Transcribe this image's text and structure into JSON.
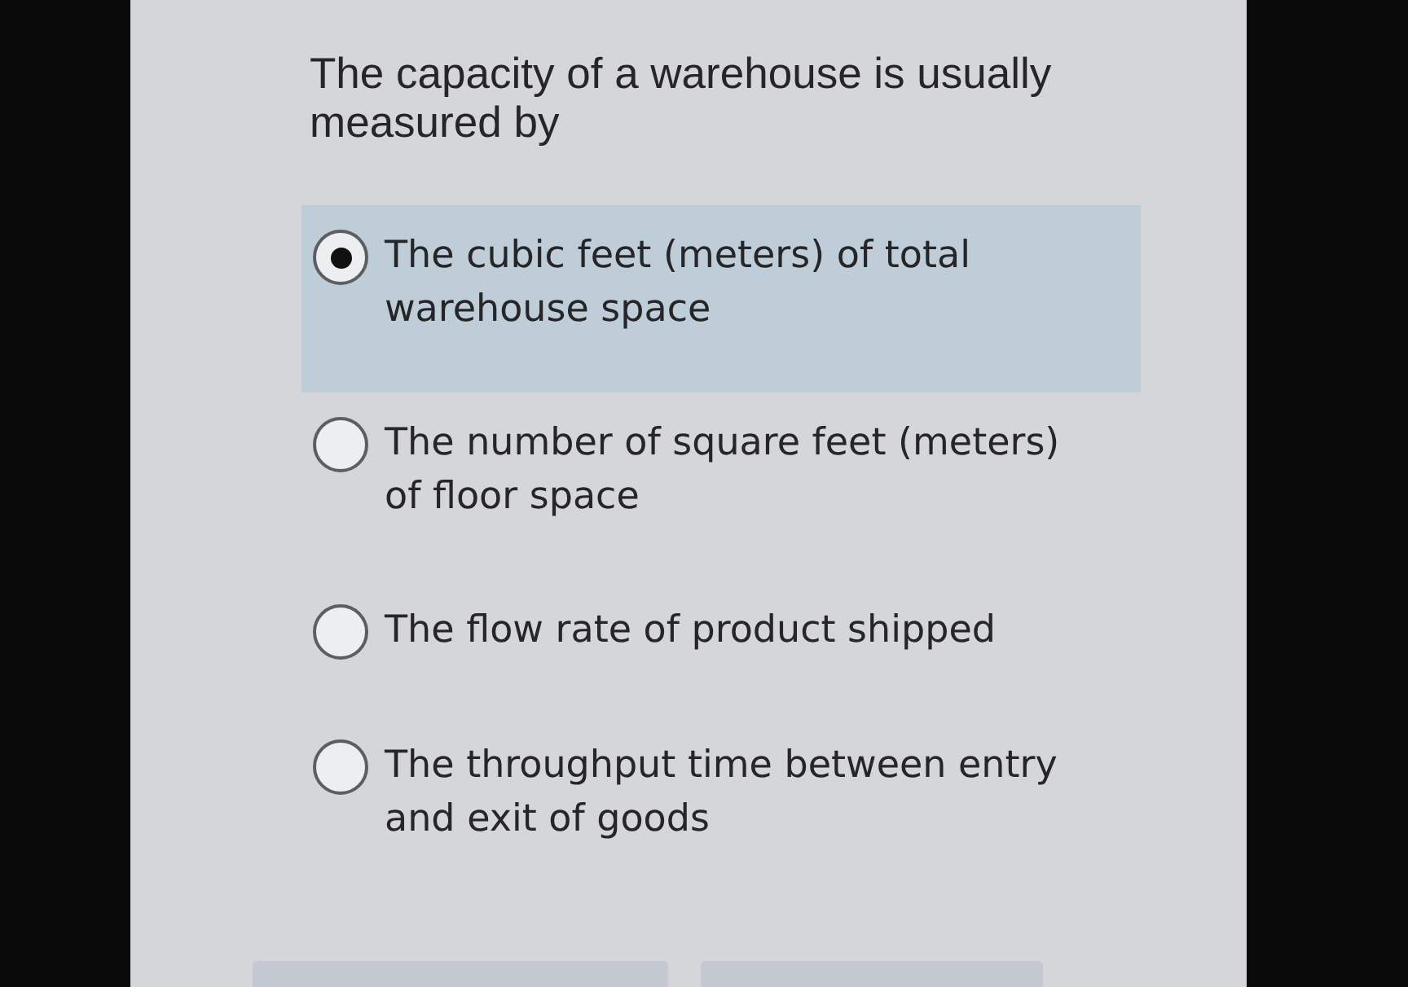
{
  "question": {
    "text": "The capacity of a warehouse is usually measured by"
  },
  "options": [
    {
      "label": "The cubic feet (meters) of total warehouse space",
      "selected": true
    },
    {
      "label": "The number of square feet (meters) of floor space",
      "selected": false
    },
    {
      "label": "The flow rate of product shipped",
      "selected": false
    },
    {
      "label": "The throughput time between entry and exit of goods",
      "selected": false
    }
  ]
}
